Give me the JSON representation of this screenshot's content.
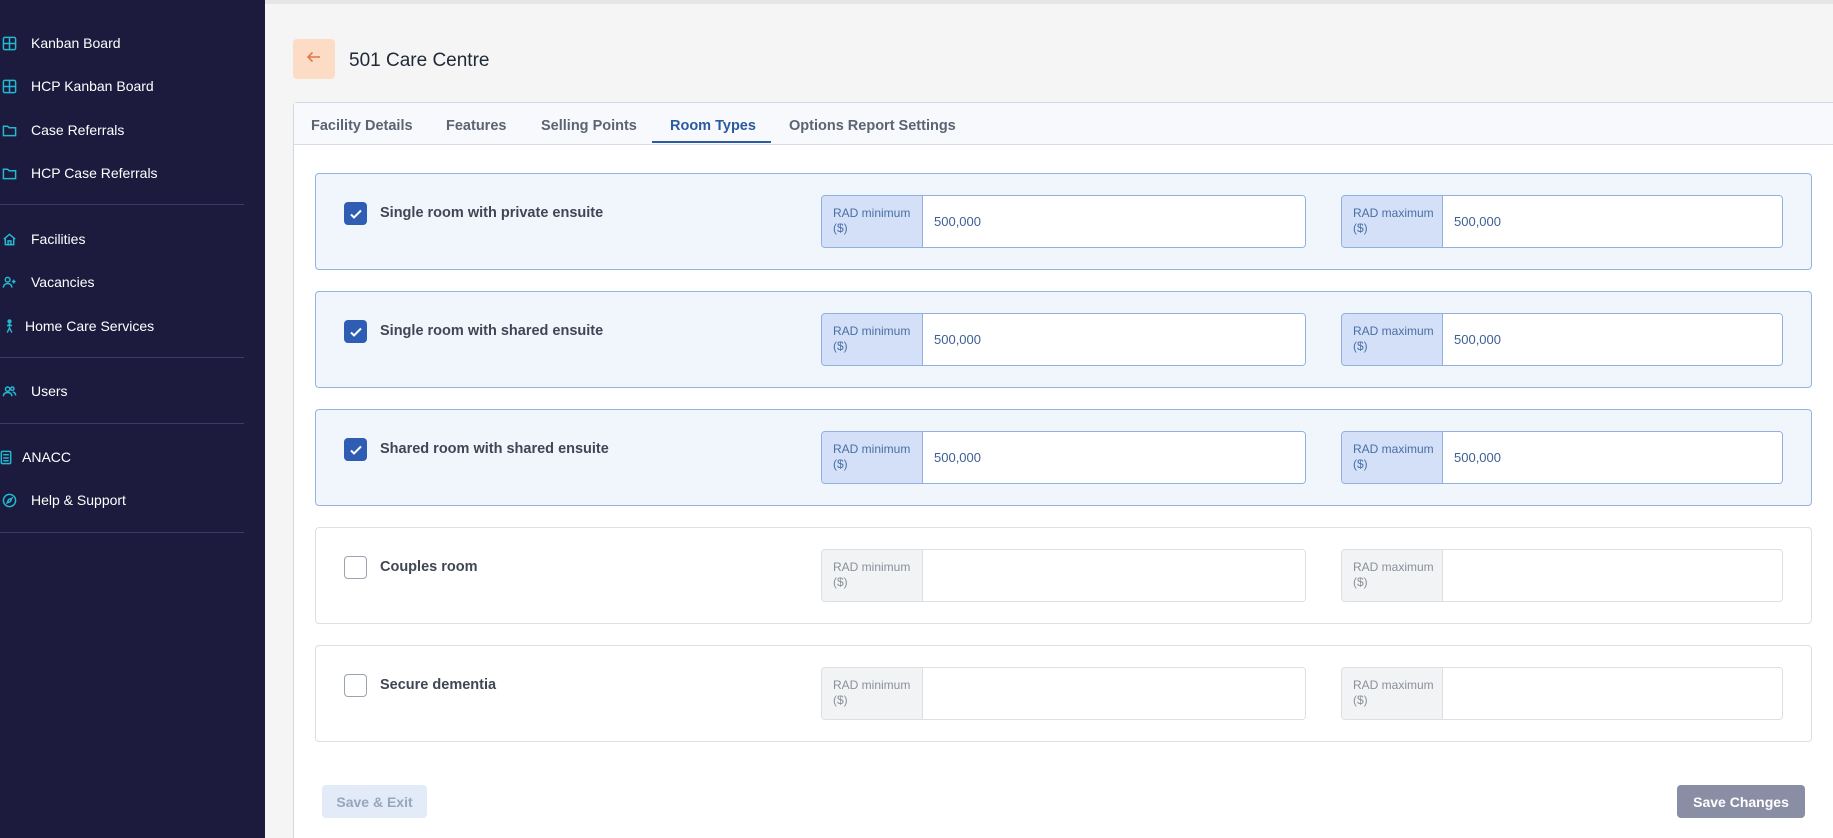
{
  "sidebar": {
    "items": [
      {
        "label": "Kanban Board",
        "icon": "grid-icon"
      },
      {
        "label": "HCP Kanban Board",
        "icon": "grid-icon"
      },
      {
        "label": "Case Referrals",
        "icon": "folder-icon"
      },
      {
        "label": "HCP Case Referrals",
        "icon": "folder-icon"
      },
      {
        "label": "Facilities",
        "icon": "home-icon"
      },
      {
        "label": "Vacancies",
        "icon": "user-add-icon"
      },
      {
        "label": "Home Care Services",
        "icon": "walking-person-icon"
      },
      {
        "label": "Users",
        "icon": "users-icon"
      },
      {
        "label": "ANACC",
        "icon": "calculator-icon"
      },
      {
        "label": "Help & Support",
        "icon": "compass-icon"
      }
    ]
  },
  "header": {
    "title": "501 Care Centre",
    "back_icon": "arrow-left-icon"
  },
  "tabs": [
    {
      "label": "Facility Details",
      "active": false
    },
    {
      "label": "Features",
      "active": false
    },
    {
      "label": "Selling Points",
      "active": false
    },
    {
      "label": "Room Types",
      "active": true
    },
    {
      "label": "Options Report Settings",
      "active": false
    }
  ],
  "rooms": [
    {
      "label": "Single room with private ensuite",
      "checked": true,
      "min_label": "RAD minimum ($)",
      "min_value": "500,000",
      "max_label": "RAD maximum ($)",
      "max_value": "500,000"
    },
    {
      "label": "Single room with shared ensuite",
      "checked": true,
      "min_label": "RAD minimum ($)",
      "min_value": "500,000",
      "max_label": "RAD maximum ($)",
      "max_value": "500,000"
    },
    {
      "label": "Shared room with shared ensuite",
      "checked": true,
      "min_label": "RAD minimum ($)",
      "min_value": "500,000",
      "max_label": "RAD maximum ($)",
      "max_value": "500,000"
    },
    {
      "label": "Couples room",
      "checked": false,
      "min_label": "RAD minimum ($)",
      "min_value": "",
      "max_label": "RAD maximum ($)",
      "max_value": ""
    },
    {
      "label": "Secure dementia",
      "checked": false,
      "min_label": "RAD minimum ($)",
      "min_value": "",
      "max_label": "RAD maximum ($)",
      "max_value": ""
    }
  ],
  "actions": {
    "save_exit_label": "Save & Exit",
    "save_changes_label": "Save Changes"
  },
  "colors": {
    "sidebar_bg": "#1c1a3d",
    "icon_accent": "#22b8cf",
    "primary": "#2c5aa0",
    "back_button_bg": "#fddcc6"
  }
}
